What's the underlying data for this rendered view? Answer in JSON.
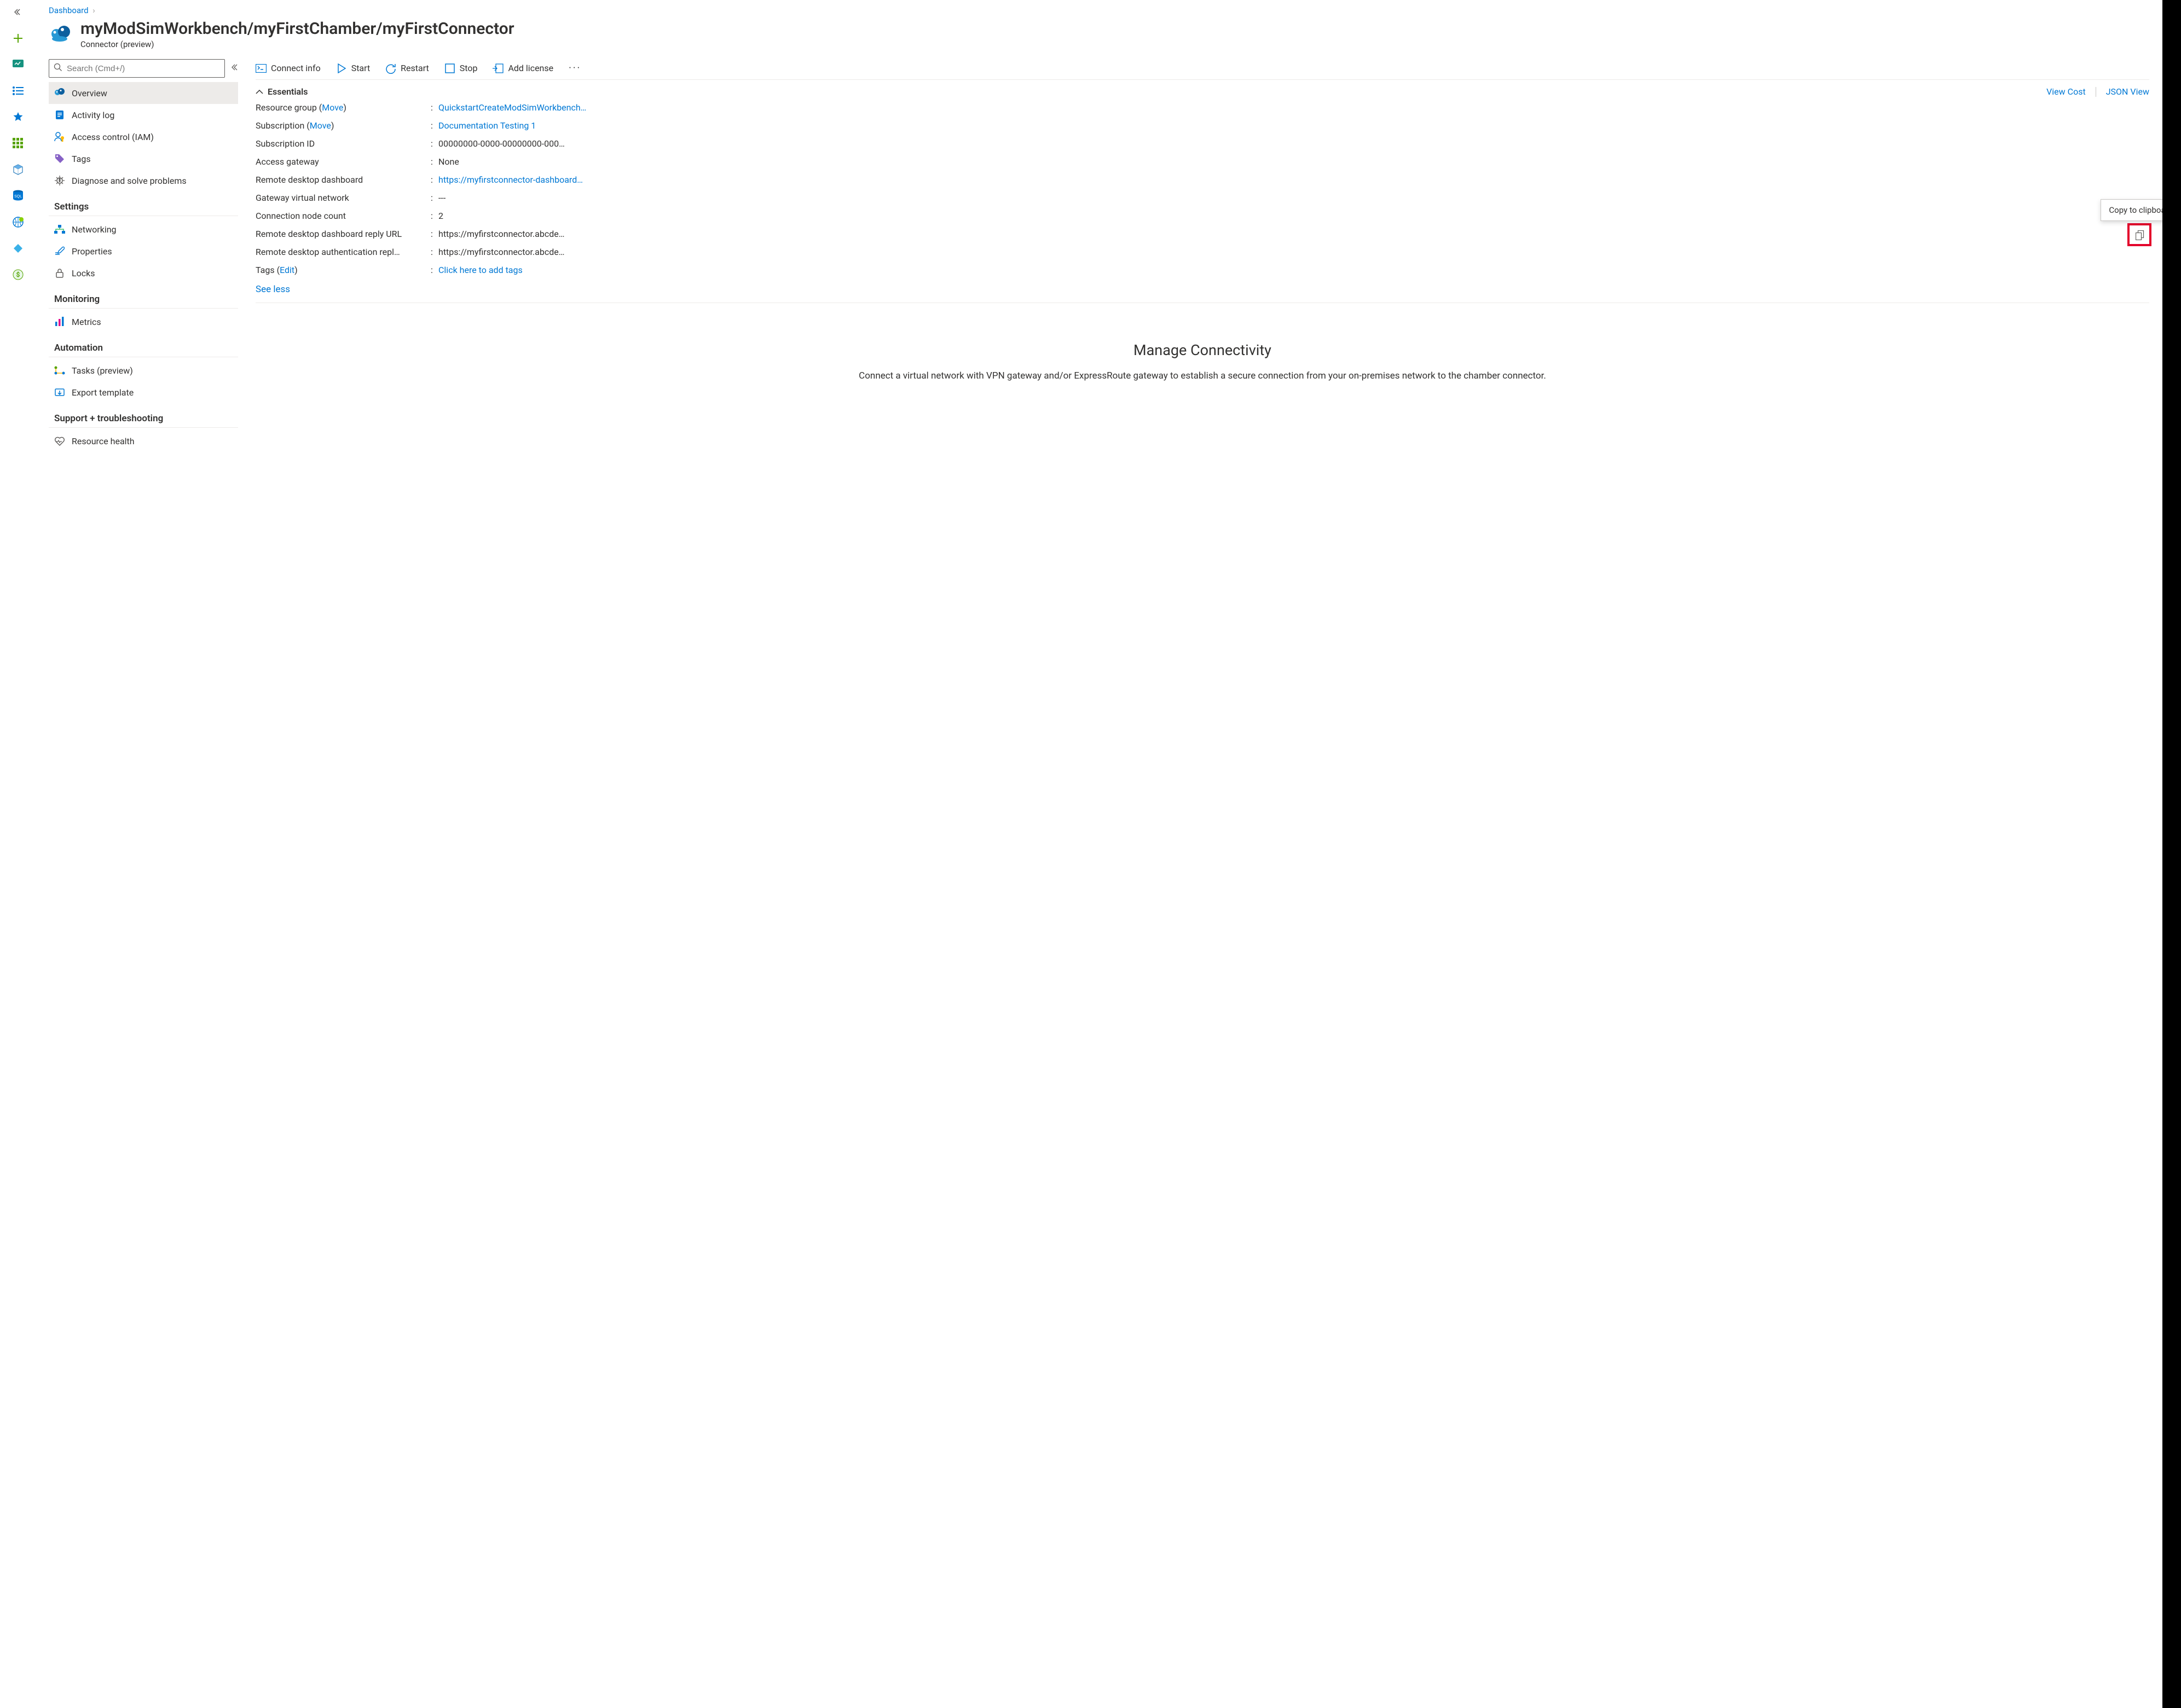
{
  "breadcrumb": {
    "label": "Dashboard"
  },
  "title": "myModSimWorkbench/myFirstChamber/myFirstConnector",
  "subtitle": "Connector (preview)",
  "search": {
    "placeholder": "Search (Cmd+/)"
  },
  "menu": {
    "overview": "Overview",
    "activitylog": "Activity log",
    "iam": "Access control (IAM)",
    "tags": "Tags",
    "diagnose": "Diagnose and solve problems",
    "group_settings": "Settings",
    "networking": "Networking",
    "properties": "Properties",
    "locks": "Locks",
    "group_monitoring": "Monitoring",
    "metrics": "Metrics",
    "group_automation": "Automation",
    "tasks": "Tasks (preview)",
    "export": "Export template",
    "group_support": "Support + troubleshooting",
    "resourcehealth": "Resource health"
  },
  "toolbar": {
    "connectinfo": "Connect info",
    "start": "Start",
    "restart": "Restart",
    "stop": "Stop",
    "addlicense": "Add license"
  },
  "essentials": {
    "header": "Essentials",
    "viewcost": "View Cost",
    "jsonview": "JSON View",
    "rows": {
      "rg_label": "Resource group",
      "rg_move": "Move",
      "rg_value": "QuickstartCreateModSimWorkbench…",
      "sub_label": "Subscription",
      "sub_move": "Move",
      "sub_value": "Documentation Testing 1",
      "subid_label": "Subscription ID",
      "subid_value": "00000000-0000-00000000-000…",
      "ag_label": "Access gateway",
      "ag_value": "None",
      "rdd_label": "Remote desktop dashboard",
      "rdd_value": "https://myfirstconnector-dashboard…",
      "gvn_label": "Gateway virtual network",
      "gvn_value": "---",
      "cnc_label": "Connection node count",
      "cnc_value": "2",
      "rddr_label": "Remote desktop dashboard reply URL",
      "rddr_value": "https://myfirstconnector.abcde…",
      "rdar_label": "Remote desktop authentication repl…",
      "rdar_value": "https://myfirstconnector.abcde…",
      "tags_label": "Tags",
      "tags_edit": "Edit",
      "tags_value": "Click here to add tags"
    },
    "seeless": "See less",
    "tooltip": "Copy to clipboard"
  },
  "connectivity": {
    "heading": "Manage Connectivity",
    "body": "Connect a virtual network with VPN gateway and/or ExpressRoute gateway to establish a secure connection from your on-premises network to the chamber connector."
  }
}
